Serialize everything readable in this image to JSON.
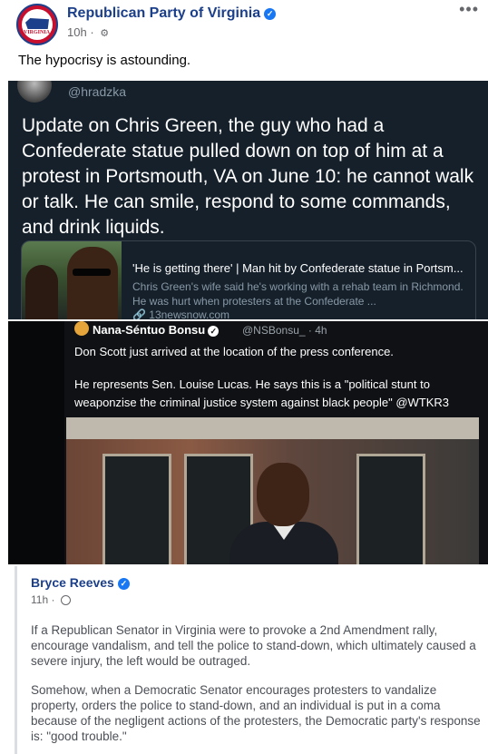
{
  "post": {
    "page_name": "Republican Party of Virginia",
    "time": "10h",
    "more_label": "•••",
    "caption": "The hypocrisy is astounding.",
    "avatar_text": "VIRGINIA"
  },
  "tweet1": {
    "handle": "@hradzka",
    "text": "Update on Chris Green, the guy who had a Confederate statue pulled down on top of him at a protest in Portsmouth, VA on June 10: he cannot walk or talk. He can smile, respond to some commands, and drink liquids.",
    "card": {
      "title": "'He is getting there' | Man hit by Confederate statue in Portsm...",
      "description": "Chris Green's wife said he's working with a rehab team in Richmond. He was hurt when protesters at the Confederate ...",
      "link": "13newsnow.com"
    }
  },
  "tweet2": {
    "author": "Nana-Séntuo Bonsu",
    "handle_time": "@NSBonsu_ · 4h",
    "line1": "Don Scott just arrived at the location of the press conference.",
    "line2": "He represents Sen. Louise Lucas. He says this is a \"political stunt to weaponzise the criminal justice system against black people\" @WTKR3"
  },
  "shared": {
    "name": "Bryce Reeves",
    "time": "11h",
    "p1": "If a Republican Senator in Virginia were to provoke a 2nd Amendment rally, encourage vandalism, and tell the police to stand-down, which ultimately caused a severe injury, the left would be outraged.",
    "p2": "Somehow, when a Democratic Senator encourages protesters to vandalize property, orders the police to stand-down, and an individual is put in a coma because of the negligent actions of the protesters, the Democratic party's response is: \"good trouble.\""
  },
  "colors": {
    "link_name": "#1c3f8a",
    "verified": "#1877f2",
    "tweet_bg": "#15202b"
  }
}
